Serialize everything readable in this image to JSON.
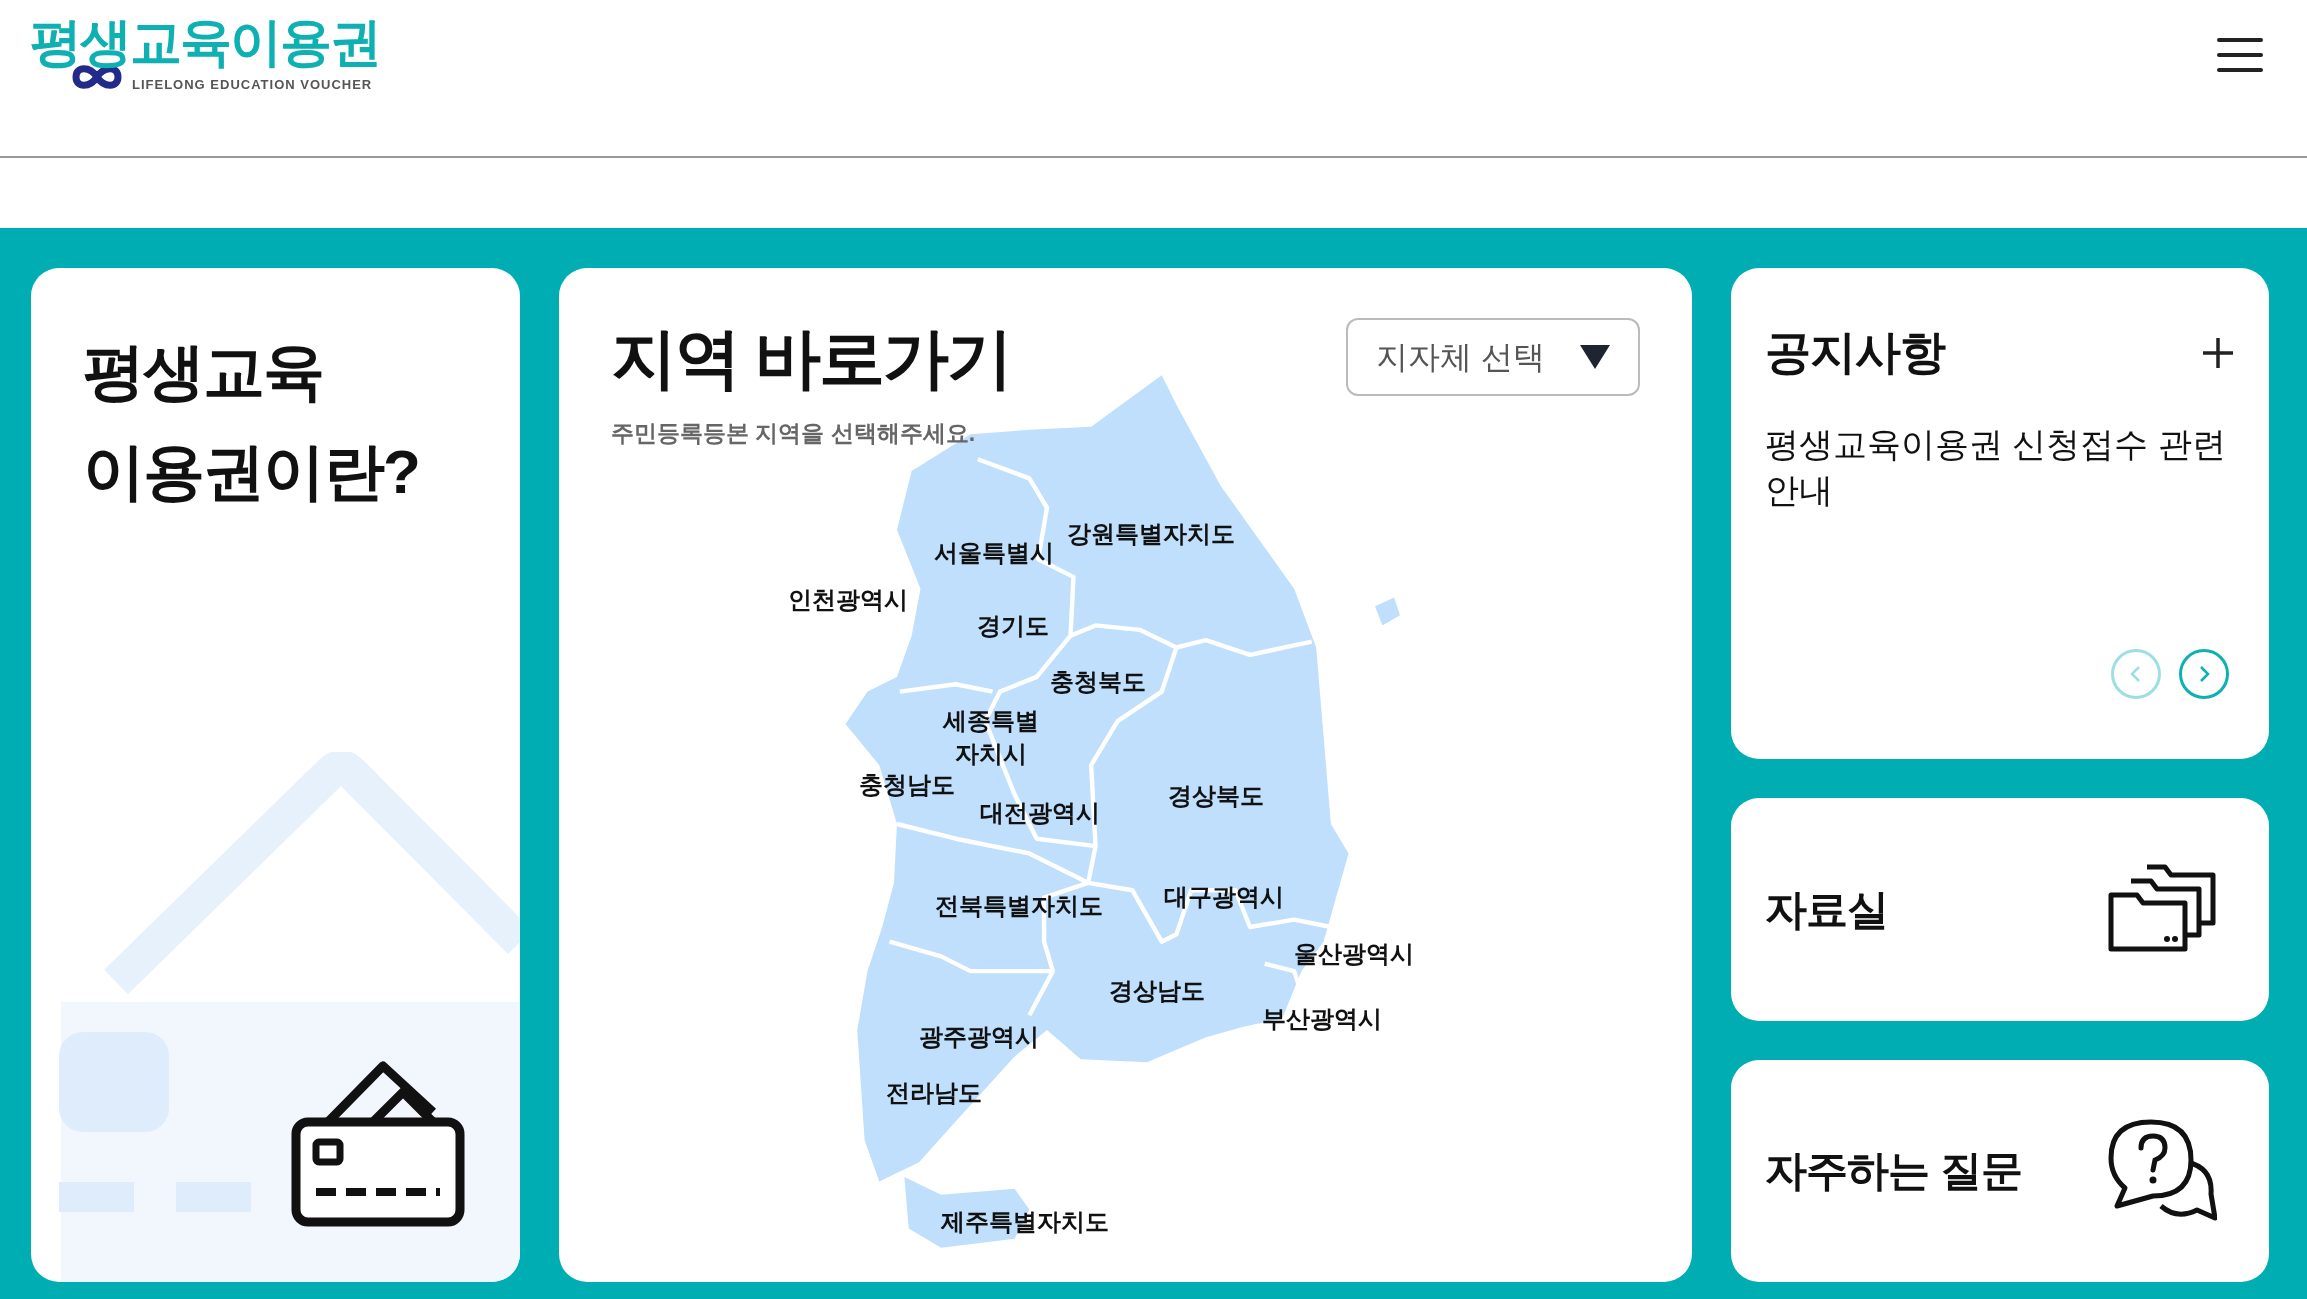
{
  "header": {
    "logo_title": "평생교육이용권",
    "logo_subtitle": "LIFELONG EDUCATION VOUCHER"
  },
  "intro_card": {
    "title_lines": [
      "평생교육",
      "이용권이란?"
    ]
  },
  "region_card": {
    "title": "지역 바로가기",
    "subtitle": "주민등록등본 지역을 선택해주세요.",
    "select": {
      "placeholder": "지자체 선택"
    },
    "regions": [
      {
        "lines": [
          "강원특별자치도"
        ]
      },
      {
        "lines": [
          "서울특별시"
        ]
      },
      {
        "lines": [
          "인천광역시"
        ]
      },
      {
        "lines": [
          "경기도"
        ]
      },
      {
        "lines": [
          "충청북도"
        ]
      },
      {
        "lines": [
          "세종특별",
          "자치시"
        ]
      },
      {
        "lines": [
          "충청남도"
        ]
      },
      {
        "lines": [
          "대전광역시"
        ]
      },
      {
        "lines": [
          "경상북도"
        ]
      },
      {
        "lines": [
          "대구광역시"
        ]
      },
      {
        "lines": [
          "전북특별자치도"
        ]
      },
      {
        "lines": [
          "울산광역시"
        ]
      },
      {
        "lines": [
          "경상남도"
        ]
      },
      {
        "lines": [
          "부산광역시"
        ]
      },
      {
        "lines": [
          "광주광역시"
        ]
      },
      {
        "lines": [
          "전라남도"
        ]
      },
      {
        "lines": [
          "제주특별자치도"
        ]
      }
    ]
  },
  "notice_card": {
    "title": "공지사항",
    "items": [
      "평생교육이용권 신청접수 관련 안내"
    ],
    "prev": {
      "disabled": true
    },
    "next": {
      "disabled": false
    }
  },
  "links": [
    {
      "label": "자료실",
      "kind": "archive"
    },
    {
      "label": "자주하는 질문",
      "kind": "faq"
    }
  ]
}
